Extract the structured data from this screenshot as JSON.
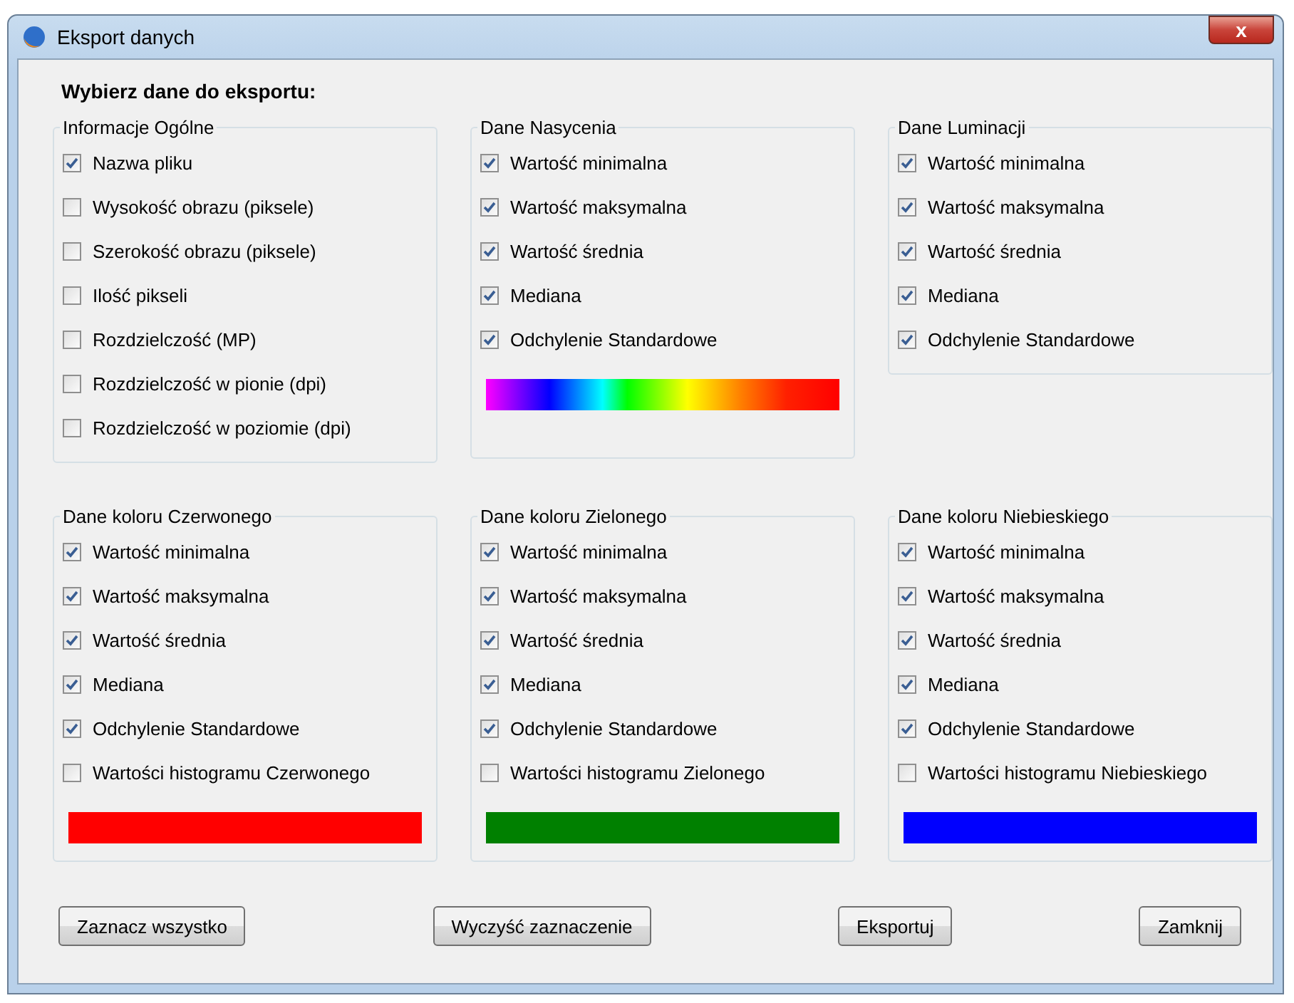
{
  "window": {
    "title": "Eksport danych",
    "close": "x"
  },
  "heading": "Wybierz dane do eksportu:",
  "groups": [
    {
      "title": "Informacje Ogólne",
      "items": [
        {
          "label": "Nazwa pliku",
          "checked": true
        },
        {
          "label": "Wysokość obrazu (piksele)",
          "checked": false
        },
        {
          "label": "Szerokość obrazu (piksele)",
          "checked": false
        },
        {
          "label": "Ilość pikseli",
          "checked": false
        },
        {
          "label": "Rozdzielczość (MP)",
          "checked": false
        },
        {
          "label": "Rozdzielczość w pionie (dpi)",
          "checked": false
        },
        {
          "label": "Rozdzielczość w poziomie (dpi)",
          "checked": false
        }
      ]
    },
    {
      "title": "Dane Nasycenia",
      "items": [
        {
          "label": "Wartość minimalna",
          "checked": true
        },
        {
          "label": "Wartość maksymalna",
          "checked": true
        },
        {
          "label": "Wartość średnia",
          "checked": true
        },
        {
          "label": "Mediana",
          "checked": true
        },
        {
          "label": "Odchylenie Standardowe",
          "checked": true
        }
      ],
      "bar": {
        "kind": "spectrum"
      }
    },
    {
      "title": "Dane Luminacji",
      "items": [
        {
          "label": "Wartość minimalna",
          "checked": true
        },
        {
          "label": "Wartość maksymalna",
          "checked": true
        },
        {
          "label": "Wartość średnia",
          "checked": true
        },
        {
          "label": "Mediana",
          "checked": true
        },
        {
          "label": "Odchylenie Standardowe",
          "checked": true
        }
      ]
    },
    {
      "title": "Dane koloru Czerwonego",
      "items": [
        {
          "label": "Wartość minimalna",
          "checked": true
        },
        {
          "label": "Wartość maksymalna",
          "checked": true
        },
        {
          "label": "Wartość średnia",
          "checked": true
        },
        {
          "label": "Mediana",
          "checked": true
        },
        {
          "label": "Odchylenie Standardowe",
          "checked": true
        },
        {
          "label": "Wartości histogramu Czerwonego",
          "checked": false
        }
      ],
      "bar": {
        "kind": "solid",
        "color": "#ff0000"
      }
    },
    {
      "title": "Dane koloru Zielonego",
      "items": [
        {
          "label": "Wartość minimalna",
          "checked": true
        },
        {
          "label": "Wartość maksymalna",
          "checked": true
        },
        {
          "label": "Wartość średnia",
          "checked": true
        },
        {
          "label": "Mediana",
          "checked": true
        },
        {
          "label": "Odchylenie Standardowe",
          "checked": true
        },
        {
          "label": "Wartości histogramu Zielonego",
          "checked": false
        }
      ],
      "bar": {
        "kind": "solid",
        "color": "#008000"
      }
    },
    {
      "title": "Dane koloru Niebieskiego",
      "items": [
        {
          "label": "Wartość minimalna",
          "checked": true
        },
        {
          "label": "Wartość maksymalna",
          "checked": true
        },
        {
          "label": "Wartość średnia",
          "checked": true
        },
        {
          "label": "Mediana",
          "checked": true
        },
        {
          "label": "Odchylenie Standardowe",
          "checked": true
        },
        {
          "label": "Wartości histogramu Niebieskiego",
          "checked": false
        }
      ],
      "bar": {
        "kind": "solid",
        "color": "#0000ff"
      }
    }
  ],
  "buttons": [
    "Zaznacz wszystko",
    "Wyczyść zaznaczenie",
    "Eksportuj",
    "Zamknij"
  ]
}
